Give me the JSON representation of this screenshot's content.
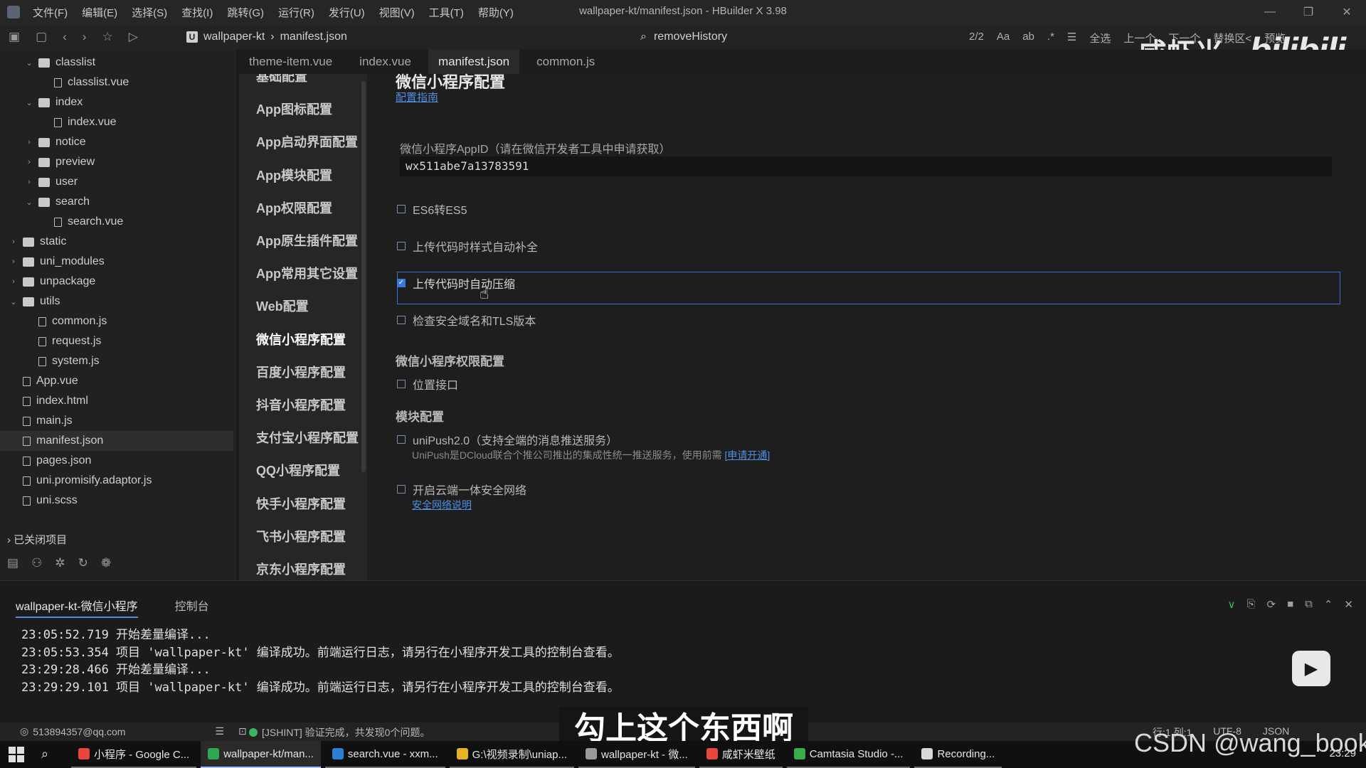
{
  "menubar": {
    "items": [
      "文件(F)",
      "编辑(E)",
      "选择(S)",
      "查找(I)",
      "跳转(G)",
      "运行(R)",
      "发行(U)",
      "视图(V)",
      "工具(T)",
      "帮助(Y)"
    ],
    "title": "wallpaper-kt/manifest.json - HBuilder X 3.98"
  },
  "toolbar": {
    "breadcrumb": [
      "wallpaper-kt",
      "manifest.json"
    ],
    "search_value": "removeHistory",
    "match_count": "2/2",
    "select_all": "全选",
    "prev": "上一个",
    "next": "下一个",
    "replace": "替换区<",
    "preview": "预览"
  },
  "tree": {
    "items": [
      {
        "label": "classlist",
        "type": "folder",
        "level": 2,
        "expanded": true
      },
      {
        "label": "classlist.vue",
        "type": "file",
        "level": 3
      },
      {
        "label": "index",
        "type": "folder",
        "level": 2,
        "expanded": true
      },
      {
        "label": "index.vue",
        "type": "file",
        "level": 3
      },
      {
        "label": "notice",
        "type": "folder",
        "level": 2,
        "expanded": false
      },
      {
        "label": "preview",
        "type": "folder",
        "level": 2,
        "expanded": false
      },
      {
        "label": "user",
        "type": "folder",
        "level": 2,
        "expanded": false
      },
      {
        "label": "search",
        "type": "folder",
        "level": 2,
        "expanded": true
      },
      {
        "label": "search.vue",
        "type": "file",
        "level": 3
      },
      {
        "label": "static",
        "type": "folder",
        "level": 1,
        "expanded": false
      },
      {
        "label": "uni_modules",
        "type": "folder",
        "level": 1,
        "expanded": false
      },
      {
        "label": "unpackage",
        "type": "folder",
        "level": 1,
        "expanded": false
      },
      {
        "label": "utils",
        "type": "folder",
        "level": 1,
        "expanded": true
      },
      {
        "label": "common.js",
        "type": "file",
        "level": 2
      },
      {
        "label": "request.js",
        "type": "file",
        "level": 2
      },
      {
        "label": "system.js",
        "type": "file",
        "level": 2
      },
      {
        "label": "App.vue",
        "type": "file",
        "level": 1
      },
      {
        "label": "index.html",
        "type": "file",
        "level": 1
      },
      {
        "label": "main.js",
        "type": "file",
        "level": 1
      },
      {
        "label": "manifest.json",
        "type": "file",
        "level": 1,
        "selected": true
      },
      {
        "label": "pages.json",
        "type": "file",
        "level": 1
      },
      {
        "label": "uni.promisify.adaptor.js",
        "type": "file",
        "level": 1
      },
      {
        "label": "uni.scss",
        "type": "file",
        "level": 1
      }
    ],
    "closed_projects": "已关闭项目"
  },
  "tabs": [
    "theme-item.vue",
    "index.vue",
    "manifest.json",
    "common.js"
  ],
  "active_tab": "manifest.json",
  "confnav": {
    "items": [
      "基础配置",
      "App图标配置",
      "App启动界面配置",
      "App模块配置",
      "App权限配置",
      "App原生插件配置",
      "App常用其它设置",
      "Web配置",
      "微信小程序配置",
      "百度小程序配置",
      "抖音小程序配置",
      "支付宝小程序配置",
      "QQ小程序配置",
      "快手小程序配置",
      "飞书小程序配置",
      "京东小程序配置"
    ]
  },
  "wechat": {
    "title": "微信小程序配置",
    "guide_link": "配置指南",
    "appid_label": "微信小程序AppID（请在微信开发者工具中申请获取）",
    "appid_value": "wx511abe7a13783591",
    "options": [
      {
        "label": "ES6转ES5",
        "checked": false
      },
      {
        "label": "上传代码时样式自动补全",
        "checked": false
      },
      {
        "label": "上传代码时自动压缩",
        "checked": true
      },
      {
        "label": "检查安全域名和TLS版本",
        "checked": false
      }
    ],
    "permission_title": "微信小程序权限配置",
    "location_label": "位置接口",
    "module_title": "模块配置",
    "unipush_label": "uniPush2.0（支持全端的消息推送服务）",
    "unipush_desc": "UniPush是DCloud联合个推公司推出的集成性统一推送服务，使用前需",
    "unipush_link": "[申请开通]",
    "secure_label": "开启云端一体安全网络",
    "secure_link": "安全网络说明"
  },
  "watermark": {
    "name": "咸虾米_",
    "brand": "bilibili"
  },
  "console": {
    "tabs": [
      "wallpaper-kt-微信小程序",
      "控制台"
    ],
    "lines": [
      "23:05:52.719 开始差量编译...",
      "23:05:53.354 项目 'wallpaper-kt' 编译成功。前端运行日志，请另行在小程序开发工具的控制台查看。",
      "23:29:28.466 开始差量编译...",
      "23:29:29.101 项目 'wallpaper-kt' 编译成功。前端运行日志，请另行在小程序开发工具的控制台查看。"
    ]
  },
  "status": {
    "user": "513894357@qq.com",
    "hint": "[JSHINT] 验证完成，共发现0个问题。",
    "position": "行:1  列:1",
    "encoding": "UTF-8",
    "language": "JSON"
  },
  "subtitle": "勾上这个东西啊",
  "csdn": "CSDN @wang_book",
  "taskbar": {
    "apps": [
      {
        "label": "小程序 - Google C...",
        "color": "#e8453c"
      },
      {
        "label": "wallpaper-kt/man...",
        "color": "#2fa84f",
        "active": true
      },
      {
        "label": "search.vue - xxm...",
        "color": "#2d7fd3"
      },
      {
        "label": "G:\\视频录制\\uniap...",
        "color": "#e6b422"
      },
      {
        "label": "wallpaper-kt - 微...",
        "color": "#9a9a9a"
      },
      {
        "label": "咸虾米壁纸",
        "color": "#e8453c"
      },
      {
        "label": "Camtasia Studio -...",
        "color": "#3cab49"
      },
      {
        "label": "Recording...",
        "color": "#d8d8d8"
      }
    ],
    "time": "23:29"
  }
}
